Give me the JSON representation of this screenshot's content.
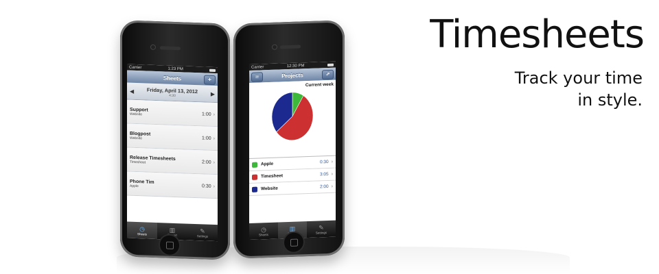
{
  "marketing": {
    "title": "Timesheets",
    "tagline_line1": "Track your time",
    "tagline_line2": "in style."
  },
  "phone_left": {
    "status": {
      "carrier": "Carrier",
      "time": "1:23 PM"
    },
    "nav": {
      "title": "Sheets",
      "add_button": "+"
    },
    "date": {
      "label": "Friday, April 13, 2012",
      "total": "4:30",
      "prev": "◀",
      "next": "▶"
    },
    "sheets": [
      {
        "title": "Support",
        "subtitle": "Website",
        "duration": "1:00"
      },
      {
        "title": "Blogpost",
        "subtitle": "Website",
        "duration": "1:00"
      },
      {
        "title": "Release Timesheets",
        "subtitle": "Timesheet",
        "duration": "2:00"
      },
      {
        "title": "Phone Tim",
        "subtitle": "Apple",
        "duration": "0:30"
      }
    ],
    "tabs": [
      {
        "label": "Sheets",
        "icon": "clock-icon",
        "active": true
      },
      {
        "label": "Report",
        "icon": "chart-icon",
        "active": false
      },
      {
        "label": "Settings",
        "icon": "wrench-icon",
        "active": false
      }
    ]
  },
  "phone_right": {
    "status": {
      "carrier": "Carrier",
      "time": "12:30 PM"
    },
    "nav": {
      "title": "Projects",
      "menu_icon": "list-icon",
      "share_icon": "share-icon"
    },
    "chart_label": "Current week",
    "projects": [
      {
        "name": "Apple",
        "duration": "0:30",
        "color": "#3db83a"
      },
      {
        "name": "Timesheet",
        "duration": "3:05",
        "color": "#cc3030"
      },
      {
        "name": "Website",
        "duration": "2:00",
        "color": "#1c2a90"
      }
    ],
    "tabs": [
      {
        "label": "Sheets",
        "icon": "clock-icon",
        "active": false
      },
      {
        "label": "Report",
        "icon": "chart-icon",
        "active": true
      },
      {
        "label": "Settings",
        "icon": "wrench-icon",
        "active": false
      }
    ]
  },
  "chart_data": {
    "type": "pie",
    "title": "Current week",
    "categories": [
      "Apple",
      "Timesheet",
      "Website"
    ],
    "values": [
      30,
      185,
      120
    ],
    "colors": [
      "#3db83a",
      "#cc3030",
      "#1c2a90"
    ]
  }
}
